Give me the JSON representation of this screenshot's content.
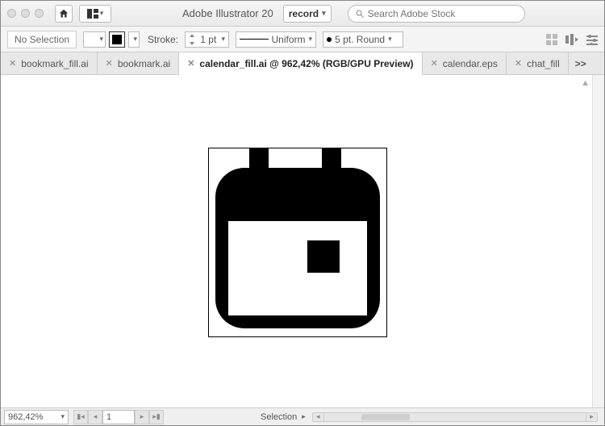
{
  "titlebar": {
    "app_title": "Adobe Illustrator 20",
    "workspace": "record",
    "search_placeholder": "Search Adobe Stock"
  },
  "controlbar": {
    "selection_label": "No Selection",
    "stroke_label": "Stroke:",
    "stroke_value": "1 pt",
    "stroke_style": "Uniform",
    "cap_label": "5 pt. Round"
  },
  "tabs": [
    {
      "label": "bookmark_fill.ai",
      "active": false
    },
    {
      "label": "bookmark.ai",
      "active": false
    },
    {
      "label": "calendar_fill.ai @ 962,42% (RGB/GPU Preview)",
      "active": true
    },
    {
      "label": "calendar.eps",
      "active": false
    },
    {
      "label": "chat_fill",
      "active": false
    }
  ],
  "tab_overflow": ">>",
  "statusbar": {
    "zoom": "962,42%",
    "page": "1",
    "tool": "Selection"
  }
}
